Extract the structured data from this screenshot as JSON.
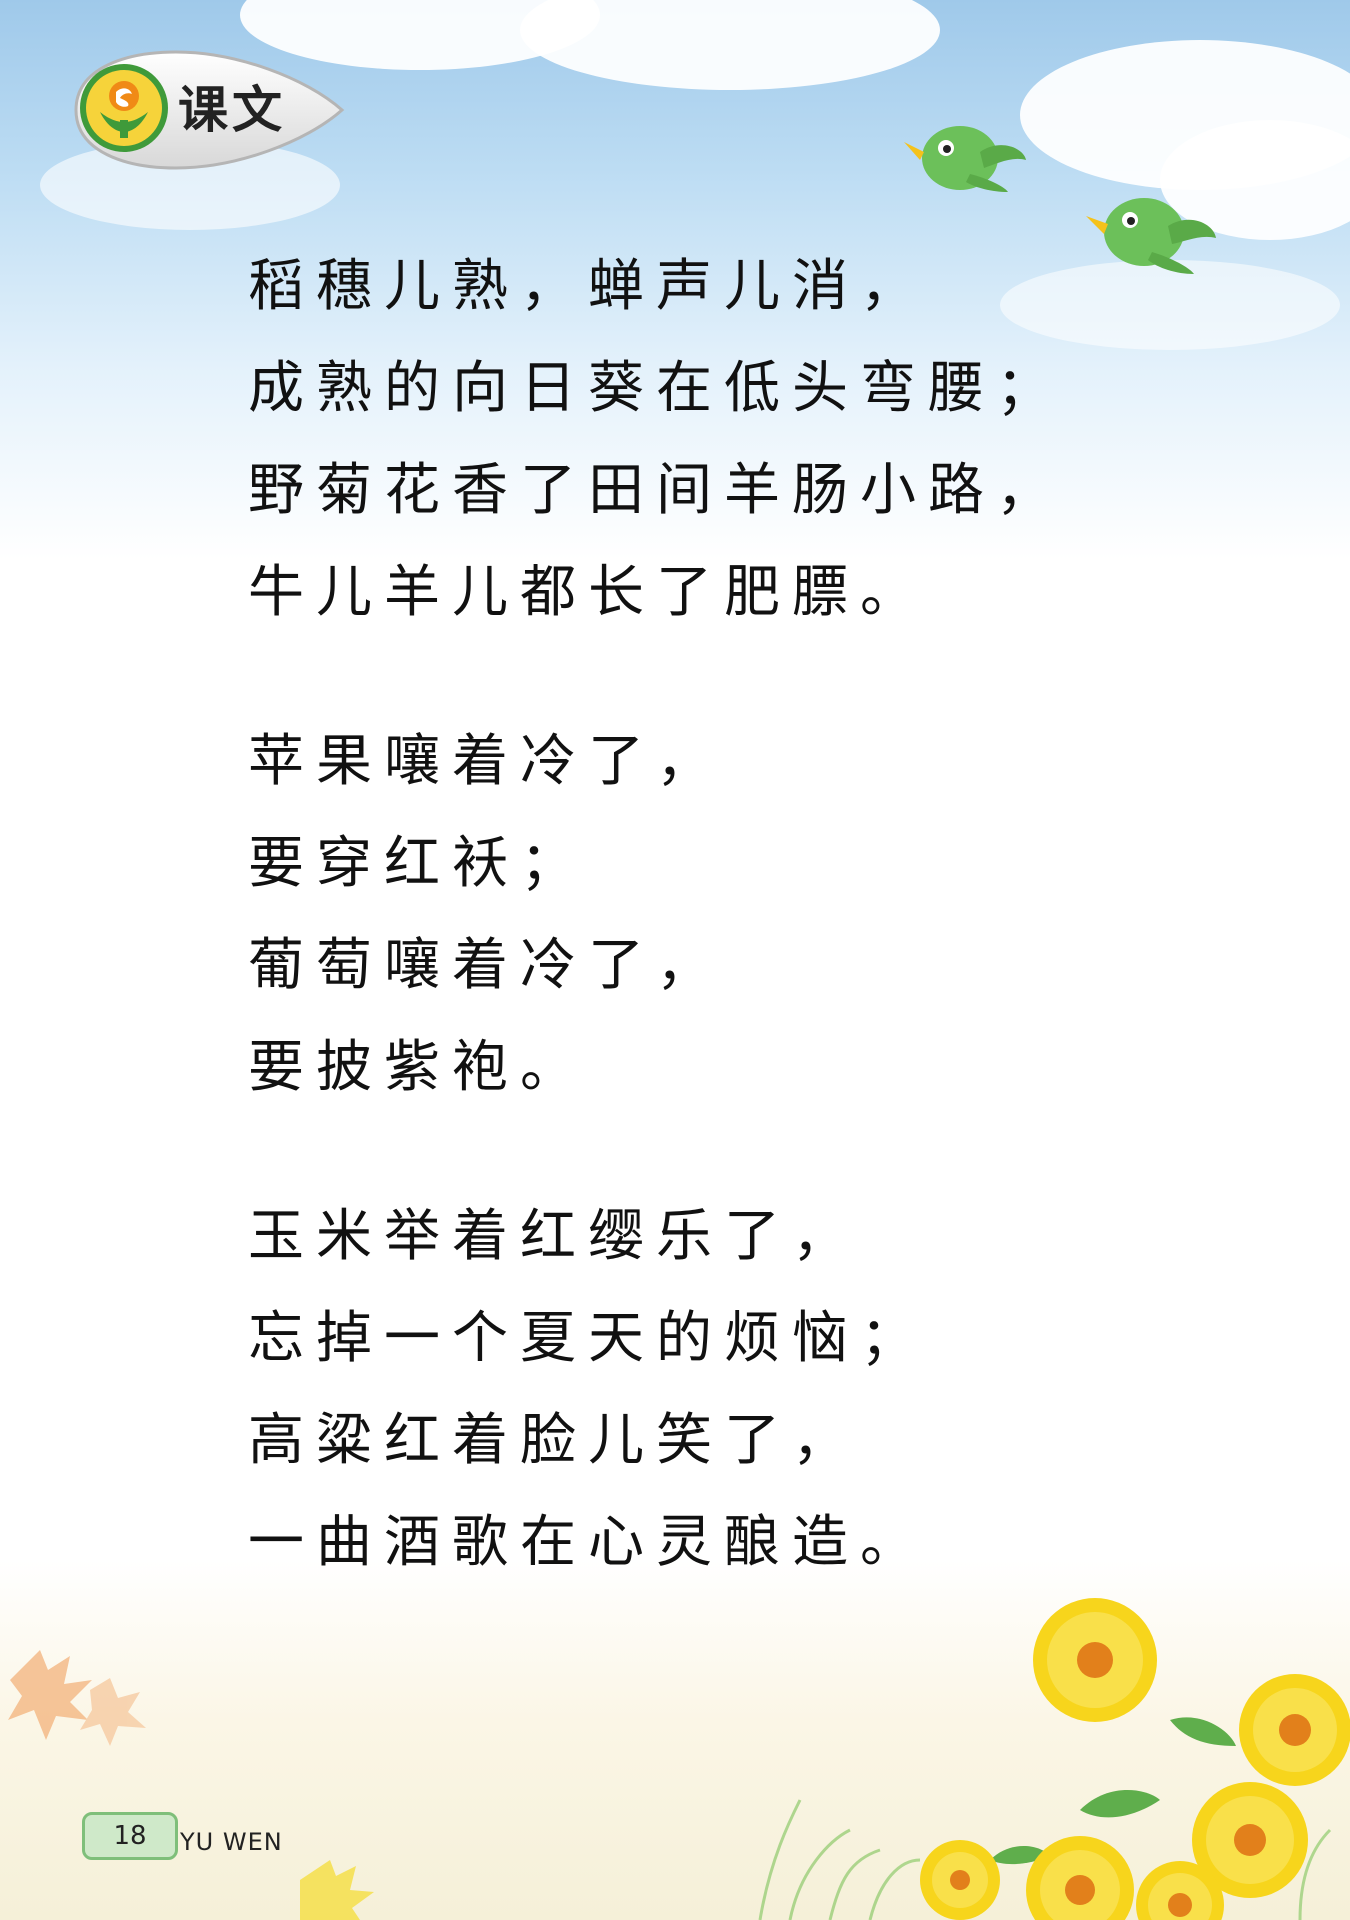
{
  "section": {
    "title": "课文",
    "logo_icon": "textbook-logo-icon"
  },
  "poem": {
    "stanzas": [
      [
        "稻穗儿熟，蝉声儿消，",
        "成熟的向日葵在低头弯腰；",
        "野菊花香了田间羊肠小路，",
        "牛儿羊儿都长了肥膘。"
      ],
      [
        "苹果嚷着冷了，",
        "要穿红袄；",
        "葡萄嚷着冷了，",
        "要披紫袍。"
      ],
      [
        "玉米举着红缨乐了，",
        "忘掉一个夏天的烦恼；",
        "高粱红着脸儿笑了，",
        "一曲酒歌在心灵酿造。"
      ]
    ]
  },
  "footer": {
    "page_number": "18",
    "subject_label": "YU WEN"
  },
  "colors": {
    "sky": "#bcdcf3",
    "badge_green": "#3f9a3a",
    "badge_orange": "#f08a16",
    "page_tab": "#cfe9c9",
    "bird_green": "#6cc05a",
    "flower_yellow": "#f7d51c"
  }
}
